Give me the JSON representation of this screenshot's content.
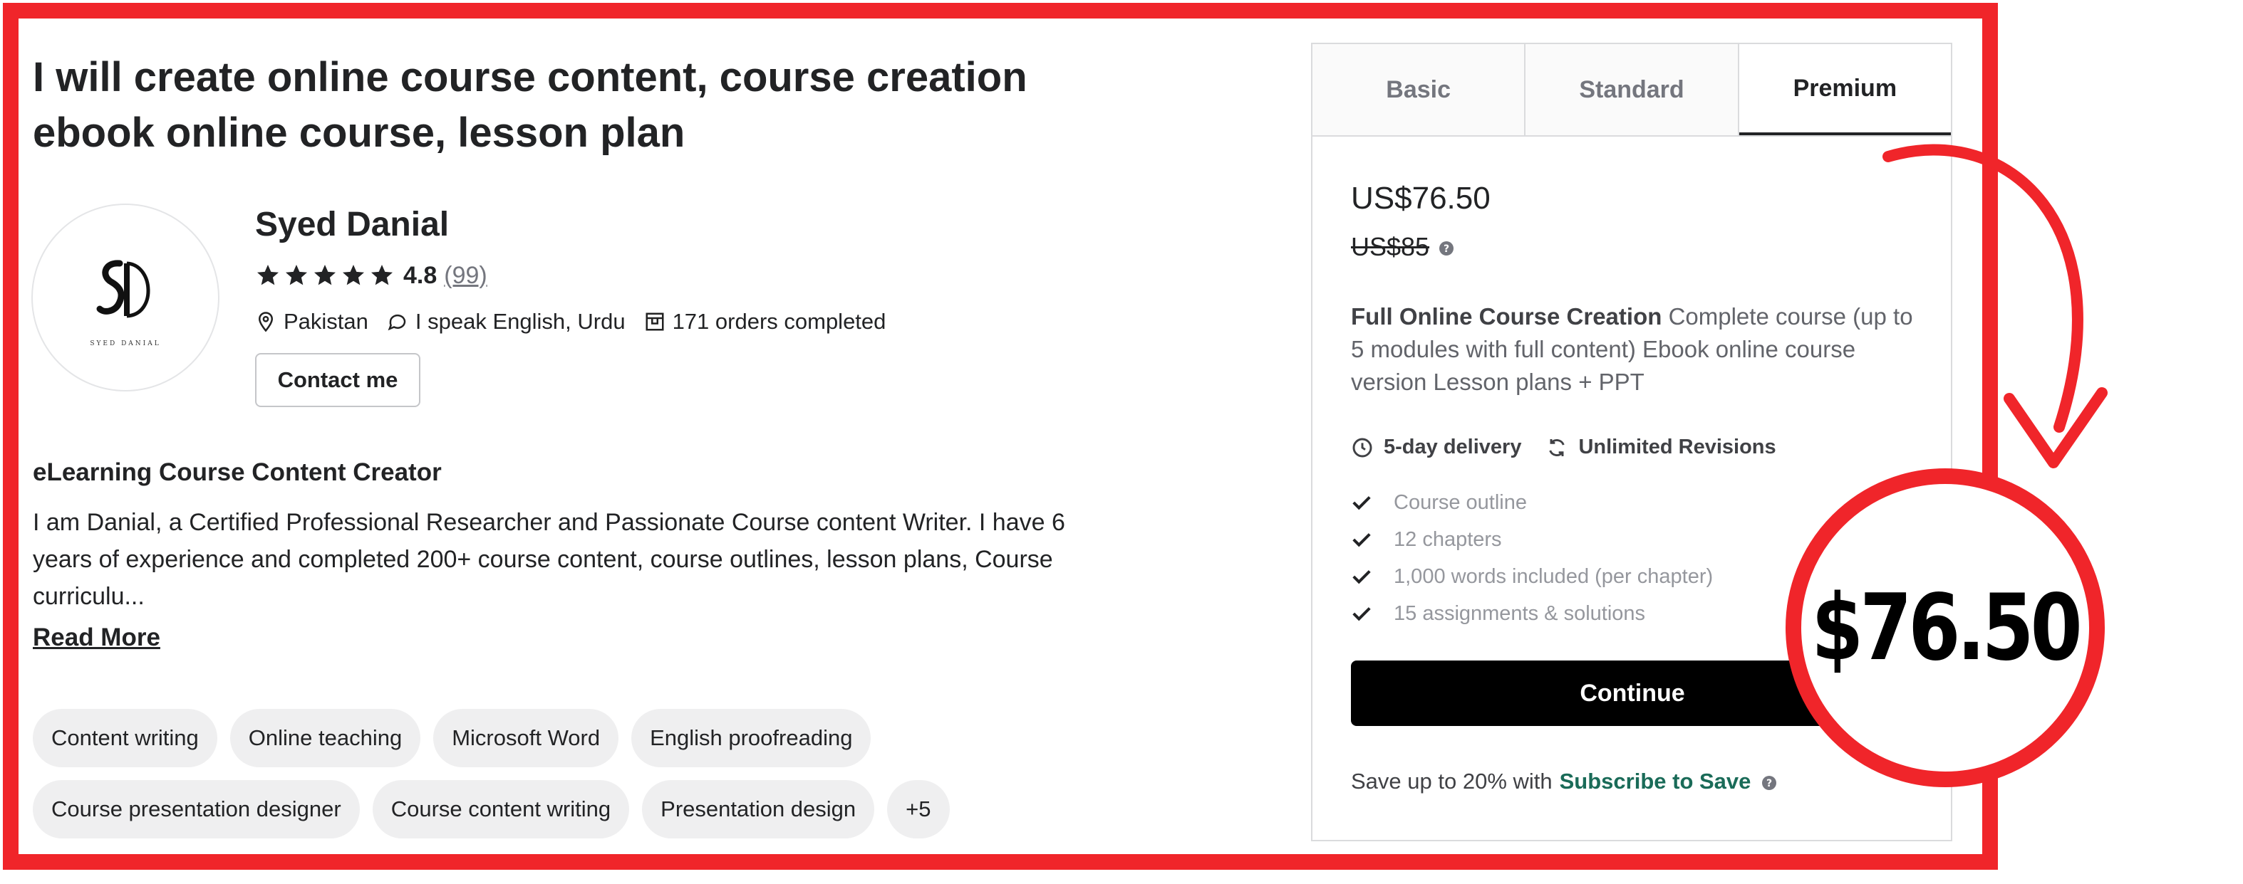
{
  "gig": {
    "title": "I will create online course content, course creation ebook online course, lesson plan"
  },
  "seller": {
    "avatar_caption": "SYED DANIAL",
    "name": "Syed Danial",
    "rating": "4.8",
    "rating_count": "(99)",
    "stars": 5,
    "location": "Pakistan",
    "languages": "I speak English, Urdu",
    "orders": "171 orders completed",
    "contact_label": "Contact me"
  },
  "about": {
    "title": "eLearning Course Content Creator",
    "description": "I am Danial, a Certified Professional Researcher and Passionate Course content Writer. I have 6 years of experience and completed 200+ course content, course outlines, lesson plans, Course curriculu...",
    "read_more": "Read More"
  },
  "tags": [
    "Content writing",
    "Online teaching",
    "Microsoft Word",
    "English proofreading",
    "Course presentation designer",
    "Course content writing",
    "Presentation design",
    "+5"
  ],
  "package": {
    "tabs": [
      "Basic",
      "Standard",
      "Premium"
    ],
    "active_tab": "Premium",
    "price": "US$76.50",
    "original_price": "US$85",
    "name": "Full Online Course Creation",
    "description": "Complete course (up to 5 modules with full content) Ebook online course version Lesson plans + PPT",
    "delivery": "5-day delivery",
    "revisions": "Unlimited Revisions",
    "features": [
      "Course outline",
      "12 chapters",
      "1,000 words included (per chapter)",
      "15 assignments & solutions"
    ],
    "continue_label": "Continue",
    "subscribe_prefix": "Save up to 20% with",
    "subscribe_link": "Subscribe to Save"
  },
  "callout": {
    "text": "$76.50"
  },
  "colors": {
    "frame": "#f0252a",
    "subscribe_link": "#1a6b58",
    "button": "#000000"
  }
}
